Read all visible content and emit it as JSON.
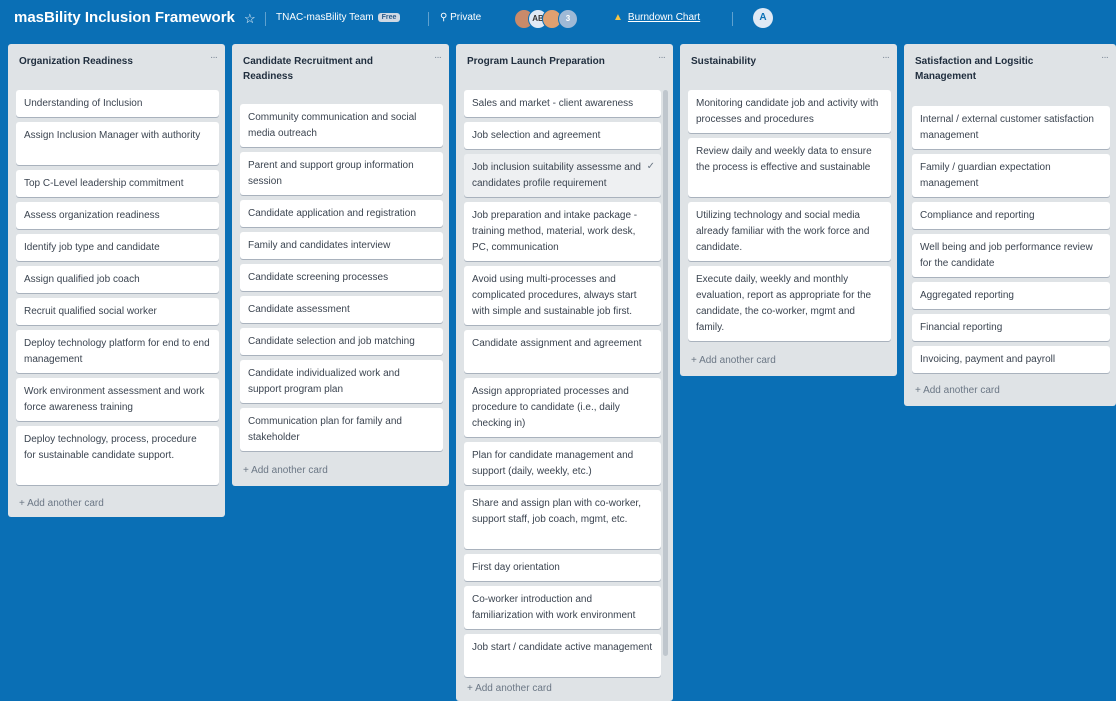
{
  "header": {
    "board_title": "masBility Inclusion Framework",
    "star_icon": "star-icon",
    "team_name": "TNAC-masBility Team",
    "team_badge": "Free",
    "privacy_label": "Private",
    "privacy_icon": "lock-icon",
    "avatar_initials": "AB",
    "avatar_count": "3",
    "powerup_label": "Burndown Chart",
    "powerup_icon": "flame-icon",
    "user_initial": "A"
  },
  "colors": {
    "board_background": "#0a6fb5",
    "list_background": "#dfe3e6",
    "card_background": "#ffffff"
  },
  "add_card_label": "+ Add another card",
  "lists": [
    {
      "title": "Organization Readiness",
      "cards": [
        "Understanding of Inclusion",
        "Assign Inclusion Manager with authority",
        "Top C-Level leadership commitment",
        "Assess organization readiness",
        "Identify job type and candidate",
        "Assign qualified job coach",
        "Recruit qualified social worker",
        "Deploy technology platform for end to end management",
        "Work environment assessment and work force awareness training",
        "Deploy technology, process, procedure for sustainable candidate support."
      ]
    },
    {
      "title": "Candidate Recruitment and Readiness",
      "cards": [
        "Community communication and social media outreach",
        "Parent and support group information session",
        "Candidate application and registration",
        "Family and candidates interview",
        "Candidate screening processes",
        "Candidate assessment",
        "Candidate selection and job matching",
        "Candidate individualized work and support program plan",
        "Communication plan for family and stakeholder"
      ]
    },
    {
      "title": "Program Launch Preparation",
      "cards": [
        "Sales and market - client awareness",
        "Job selection and agreement",
        "Job inclusion suitability assessme and candidates profile requirement",
        "Job preparation and intake package - training method, material, work desk, PC, communication",
        "Avoid using multi-processes and complicated procedures, always start with simple and sustainable job first.",
        "Candidate assignment and agreement",
        "Assign appropriated processes and procedure to candidate (i.e., daily checking in)",
        "Plan for candidate management and support (daily, weekly, etc.)",
        "Share and assign plan with co-worker, support staff, job coach, mgmt, etc.",
        "First day orientation",
        "Co-worker introduction and familiarization with work environment",
        "Job start / candidate active management"
      ]
    },
    {
      "title": "Sustainability",
      "cards": [
        "Monitoring candidate job and activity with processes and procedures",
        "Review daily and weekly data to ensure the process is effective and sustainable",
        "Utilizing technology and social media already familiar with the work force and candidate.",
        "Execute daily, weekly and monthly evaluation, report as appropriate for the candidate, the co-worker, mgmt and family."
      ]
    },
    {
      "title": "Satisfaction and Logsitic Management",
      "cards": [
        "Internal / external customer satisfaction management",
        "Family / guardian expectation management",
        "Compliance and reporting",
        "Well being and job performance review for the candidate",
        "Aggregated reporting",
        "Financial reporting",
        "Invoicing, payment and payroll"
      ]
    }
  ]
}
